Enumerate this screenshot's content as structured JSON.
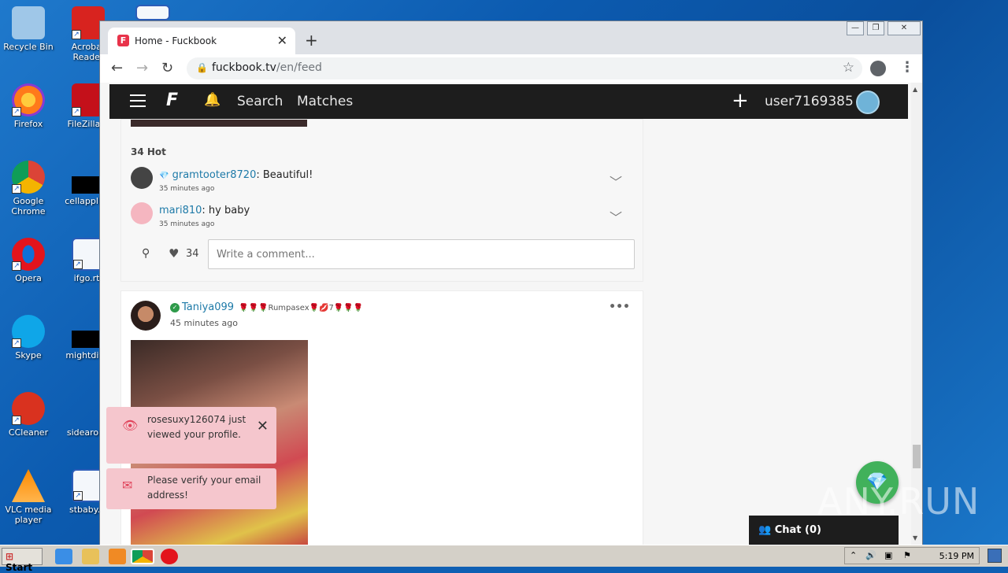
{
  "desktop": {
    "icons": [
      {
        "label": "Recycle Bin",
        "color": "#5fb0e8"
      },
      {
        "label": "Acrobat Reader",
        "color": "#d8231f"
      },
      {
        "label": "Firefox",
        "color": "#ff7a1a"
      },
      {
        "label": "FileZilla C",
        "color": "#c4101a"
      },
      {
        "label": "Google Chrome",
        "color": "#4285f4"
      },
      {
        "label": "cellapplied",
        "color": "#111111"
      },
      {
        "label": "Opera",
        "color": "#e3141c"
      },
      {
        "label": "ifgo.rtf",
        "color": "#2b5cb8"
      },
      {
        "label": "Skype",
        "color": "#0fa6e8"
      },
      {
        "label": "mightdivis",
        "color": "#111111"
      },
      {
        "label": "CCleaner",
        "color": "#d9321f"
      },
      {
        "label": "sidearoun",
        "color": "#1a66c0"
      },
      {
        "label": "VLC media player",
        "color": "#ff8a00"
      },
      {
        "label": "stbaby.rt",
        "color": "#2b5cb8"
      }
    ]
  },
  "browser": {
    "tab_title": "Home - Fuckbook",
    "tab_favicon": "F",
    "url_host": "fuckbook.tv",
    "url_path": "/en/feed"
  },
  "site": {
    "logo": "F",
    "nav_search": "Search",
    "nav_matches": "Matches",
    "username": "user7169385"
  },
  "post1": {
    "hot_count": "34 Hot",
    "comments": [
      {
        "user": "gramtooter8720",
        "text": ": Beautiful!",
        "time": "35 minutes ago",
        "badge": "💎"
      },
      {
        "user": "mari810",
        "text": ": hy baby",
        "time": "35 minutes ago"
      }
    ],
    "like_count": "34",
    "comment_placeholder": "Write a comment..."
  },
  "post2": {
    "author": "Taniya099",
    "bio": "🌹🌹🌹Rumpasex🌹💋7🌹🌹🌹",
    "time": "45 minutes ago"
  },
  "toasts": [
    {
      "text": "rosesuxy126074 just viewed your profile."
    },
    {
      "text": "Please verify your email address!"
    }
  ],
  "chat_label": "Chat (0)",
  "watermark": "ANY.RUN",
  "taskbar": {
    "start": "Start",
    "clock": "5:19 PM"
  }
}
